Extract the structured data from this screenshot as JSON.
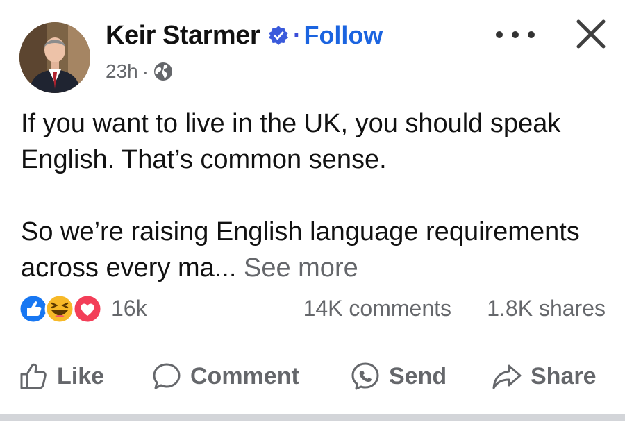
{
  "post": {
    "author": "Keir Starmer",
    "follow_label": "Follow",
    "separator": "·",
    "time": "23h",
    "text_line1": "If you want to live in the UK, you should speak English. That’s common sense.",
    "text_line2": "So we’re raising English language requirements across every ma...",
    "see_more": "See more"
  },
  "engagement": {
    "reaction_count": "16k",
    "comments": "14K comments",
    "shares": "1.8K shares",
    "reaction_types": [
      "like",
      "haha",
      "love"
    ]
  },
  "actions": {
    "like": "Like",
    "comment": "Comment",
    "send": "Send",
    "share": "Share"
  },
  "colors": {
    "follow": "#1b64e0",
    "verified": "#3b5bdb",
    "muted_text": "#65676b",
    "like_reaction": "#1877f2",
    "haha_reaction": "#f7b928",
    "love_reaction": "#f33e58"
  },
  "icons": {
    "verified": "verified-badge-icon",
    "privacy": "globe-icon",
    "more": "more-options-icon",
    "close": "close-icon",
    "like": "thumbs-up-icon",
    "comment": "comment-bubble-icon",
    "send": "messenger-icon",
    "share": "share-arrow-icon"
  }
}
